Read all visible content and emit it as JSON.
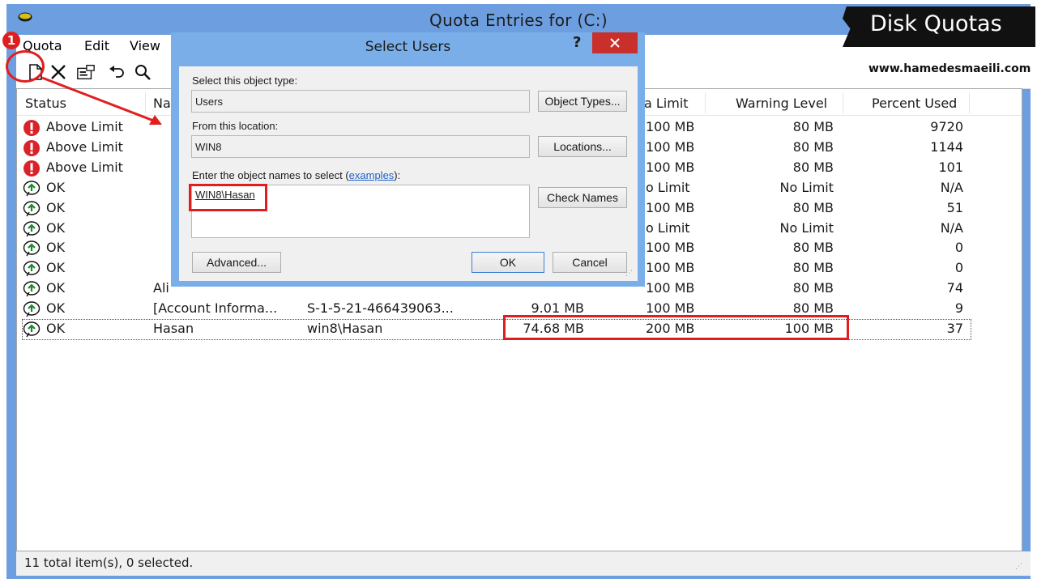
{
  "window": {
    "title": "Quota Entries for  (C:)"
  },
  "menu": [
    {
      "label": "Quota"
    },
    {
      "label": "Edit"
    },
    {
      "label": "View"
    }
  ],
  "toolbar": [
    "new-quota-entry-icon",
    "delete-icon",
    "properties-icon",
    "undo-icon",
    "find-icon"
  ],
  "columns": [
    "Status",
    "Na",
    "a Limit",
    "Warning Level",
    "Percent Used"
  ],
  "rows": [
    {
      "status": "Above Limit",
      "icon": "error-icon",
      "name": "",
      "logon": "",
      "used": "",
      "limit": "100 MB",
      "warning": "80 MB",
      "percent": "9720"
    },
    {
      "status": "Above Limit",
      "icon": "error-icon",
      "name": "",
      "logon": "",
      "used": "",
      "limit": "100 MB",
      "warning": "80 MB",
      "percent": "1144"
    },
    {
      "status": "Above Limit",
      "icon": "error-icon",
      "name": "",
      "logon": "",
      "used": "",
      "limit": "100 MB",
      "warning": "80 MB",
      "percent": "101"
    },
    {
      "status": "OK",
      "icon": "ok-icon",
      "name": "",
      "logon": "",
      "used": "",
      "limit": "o Limit",
      "warning": "No Limit",
      "percent": "N/A"
    },
    {
      "status": "OK",
      "icon": "ok-icon",
      "name": "",
      "logon": "",
      "used": "",
      "limit": "100 MB",
      "warning": "80 MB",
      "percent": "51"
    },
    {
      "status": "OK",
      "icon": "ok-icon",
      "name": "",
      "logon": "",
      "used": "",
      "limit": "o Limit",
      "warning": "No Limit",
      "percent": "N/A"
    },
    {
      "status": "OK",
      "icon": "ok-icon",
      "name": "",
      "logon": "",
      "used": "",
      "limit": "100 MB",
      "warning": "80 MB",
      "percent": "0"
    },
    {
      "status": "OK",
      "icon": "ok-icon",
      "name": "",
      "logon": "",
      "used": "",
      "limit": "100 MB",
      "warning": "80 MB",
      "percent": "0"
    },
    {
      "status": "OK",
      "icon": "ok-icon",
      "name": "Ali",
      "logon": "",
      "used": "",
      "limit": "100 MB",
      "warning": "80 MB",
      "percent": "74"
    },
    {
      "status": "OK",
      "icon": "ok-icon",
      "name": "[Account Informa...",
      "logon": "S-1-5-21-466439063...",
      "used": "9.01 MB",
      "limit": "100 MB",
      "warning": "80 MB",
      "percent": "9"
    },
    {
      "status": "OK",
      "icon": "ok-icon",
      "name": "Hasan",
      "logon": "win8\\Hasan",
      "used": "74.68 MB",
      "limit": "200 MB",
      "warning": "100 MB",
      "percent": "37"
    }
  ],
  "statusbar": {
    "text": "11 total item(s), 0 selected."
  },
  "dialog": {
    "title": "Select Users",
    "help": "?",
    "object_type_label": "Select this object type:",
    "object_type_value": "Users",
    "object_types_button": "Object Types...",
    "location_label": "From this location:",
    "location_value": "WIN8",
    "locations_button": "Locations...",
    "names_label_prefix": "Enter the object names to select (",
    "names_label_link": "examples",
    "names_label_suffix": "):",
    "names_value": "WIN8\\Hasan",
    "check_names_button": "Check Names",
    "advanced_button": "Advanced...",
    "ok_button": "OK",
    "cancel_button": "Cancel"
  },
  "overlay": {
    "badge": "Disk Quotas",
    "website": "www.hamedesmaeili.com",
    "step": "1"
  },
  "colors": {
    "window_frame": "#6d9fe0",
    "dialog_frame": "#7aaee8",
    "close_button": "#c9302c",
    "annotation_red": "#e01e1e"
  }
}
